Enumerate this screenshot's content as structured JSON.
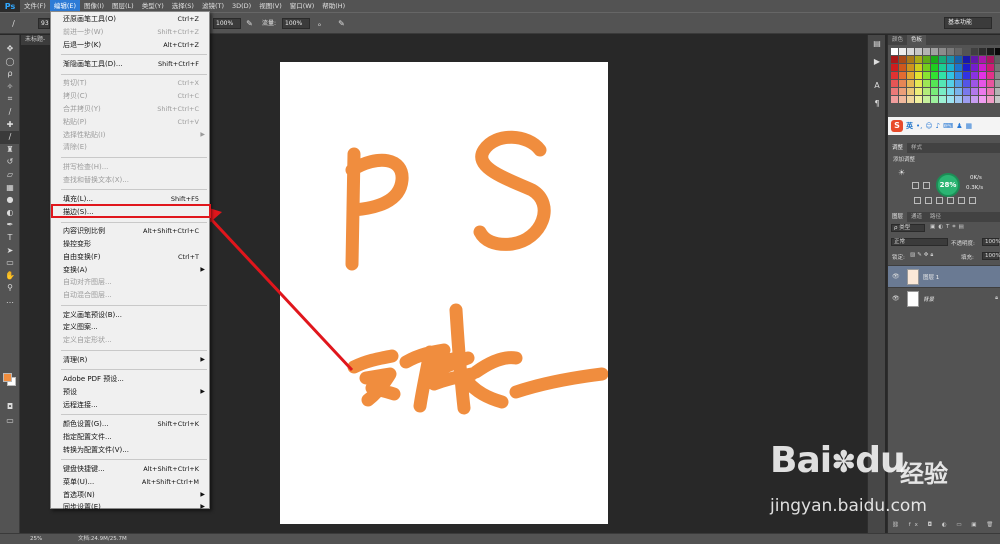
{
  "app": {
    "logo": "Ps"
  },
  "menubar": {
    "items": [
      "文件(F)",
      "编辑(E)",
      "图像(I)",
      "图层(L)",
      "类型(Y)",
      "选择(S)",
      "滤镜(T)",
      "3D(D)",
      "视图(V)",
      "窗口(W)",
      "帮助(H)"
    ],
    "active_index": 1
  },
  "options_bar": {
    "brush_size": "93",
    "opacity_label": "不透明度:",
    "opacity_value": "100%",
    "flow_label": "流量:",
    "flow_value": "100%",
    "workspace": "基本功能"
  },
  "document": {
    "tab_label": "未标题-"
  },
  "edit_menu": {
    "items": [
      {
        "label": "还原画笔工具(O)",
        "shortcut": "Ctrl+Z",
        "enabled": true
      },
      {
        "label": "前进一步(W)",
        "shortcut": "Shift+Ctrl+Z",
        "enabled": false
      },
      {
        "label": "后退一步(K)",
        "shortcut": "Alt+Ctrl+Z",
        "enabled": true
      },
      {
        "sep": true
      },
      {
        "label": "渐隐画笔工具(D)...",
        "shortcut": "Shift+Ctrl+F",
        "enabled": true
      },
      {
        "sep": true
      },
      {
        "label": "剪切(T)",
        "shortcut": "Ctrl+X",
        "enabled": false
      },
      {
        "label": "拷贝(C)",
        "shortcut": "Ctrl+C",
        "enabled": false
      },
      {
        "label": "合并拷贝(Y)",
        "shortcut": "Shift+Ctrl+C",
        "enabled": false
      },
      {
        "label": "粘贴(P)",
        "shortcut": "Ctrl+V",
        "enabled": false
      },
      {
        "label": "选择性粘贴(I)",
        "shortcut": "",
        "enabled": false,
        "submenu": true
      },
      {
        "label": "清除(E)",
        "shortcut": "",
        "enabled": false
      },
      {
        "sep": true
      },
      {
        "label": "拼写检查(H)...",
        "shortcut": "",
        "enabled": false
      },
      {
        "label": "查找和替换文本(X)...",
        "shortcut": "",
        "enabled": false
      },
      {
        "sep": true
      },
      {
        "label": "填充(L)...",
        "shortcut": "Shift+F5",
        "enabled": true
      },
      {
        "label": "描边(S)...",
        "shortcut": "",
        "enabled": true
      },
      {
        "sep": true
      },
      {
        "label": "内容识别比例",
        "shortcut": "Alt+Shift+Ctrl+C",
        "enabled": true
      },
      {
        "label": "操控变形",
        "shortcut": "",
        "enabled": true
      },
      {
        "label": "自由变换(F)",
        "shortcut": "Ctrl+T",
        "enabled": true
      },
      {
        "label": "变换(A)",
        "shortcut": "",
        "enabled": true,
        "submenu": true
      },
      {
        "label": "自动对齐图层...",
        "shortcut": "",
        "enabled": false
      },
      {
        "label": "自动混合图层...",
        "shortcut": "",
        "enabled": false
      },
      {
        "sep": true
      },
      {
        "label": "定义画笔预设(B)...",
        "shortcut": "",
        "enabled": true
      },
      {
        "label": "定义图案...",
        "shortcut": "",
        "enabled": true
      },
      {
        "label": "定义自定形状...",
        "shortcut": "",
        "enabled": false
      },
      {
        "sep": true
      },
      {
        "label": "清理(R)",
        "shortcut": "",
        "enabled": true,
        "submenu": true
      },
      {
        "sep": true
      },
      {
        "label": "Adobe PDF 预设...",
        "shortcut": "",
        "enabled": true
      },
      {
        "label": "预设",
        "shortcut": "",
        "enabled": true,
        "submenu": true
      },
      {
        "label": "远程连接...",
        "shortcut": "",
        "enabled": true
      },
      {
        "sep": true
      },
      {
        "label": "颜色设置(G)...",
        "shortcut": "Shift+Ctrl+K",
        "enabled": true
      },
      {
        "label": "指定配置文件...",
        "shortcut": "",
        "enabled": true
      },
      {
        "label": "转换为配置文件(V)...",
        "shortcut": "",
        "enabled": true
      },
      {
        "sep": true
      },
      {
        "label": "键盘快捷键...",
        "shortcut": "Alt+Shift+Ctrl+K",
        "enabled": true
      },
      {
        "label": "菜单(U)...",
        "shortcut": "Alt+Shift+Ctrl+M",
        "enabled": true
      },
      {
        "label": "首选项(N)",
        "shortcut": "",
        "enabled": true,
        "submenu": true
      },
      {
        "label": "同步设置(E)",
        "shortcut": "",
        "enabled": true,
        "submenu": true
      }
    ]
  },
  "panels": {
    "color_tabs": [
      "颜色",
      "色板"
    ],
    "ime": {
      "logo": "S",
      "text": "英"
    },
    "adjust_tabs": [
      "调整",
      "样式"
    ],
    "adjust_title": "添加调整",
    "speed": {
      "percent": "28%",
      "up": "0K/s",
      "down": "0.3K/s"
    },
    "layer_tabs": [
      "图层",
      "通道",
      "路径"
    ],
    "kind_label": "ρ 类型",
    "blend_mode": "正常",
    "opacity_label": "不透明度:",
    "opacity_value": "100%",
    "lock_label": "锁定:",
    "fill_label": "填充:",
    "fill_value": "100%",
    "layers": [
      {
        "name": "图层 1",
        "selected": true
      },
      {
        "name": "背景",
        "selected": false
      }
    ]
  },
  "status": {
    "zoom": "25%",
    "doc_info": "文档:24.9M/25.7M"
  },
  "canvas_art": {
    "stroke_color": "#f08d3e",
    "text": "PS"
  },
  "watermark": {
    "brand": "Bai",
    "brand2": "du",
    "cn": "经验",
    "url": "jingyan.baidu.com"
  },
  "colors": {
    "accent": "#2d7bd6",
    "highlight": "#e0161c",
    "brush": "#f08d3e"
  }
}
